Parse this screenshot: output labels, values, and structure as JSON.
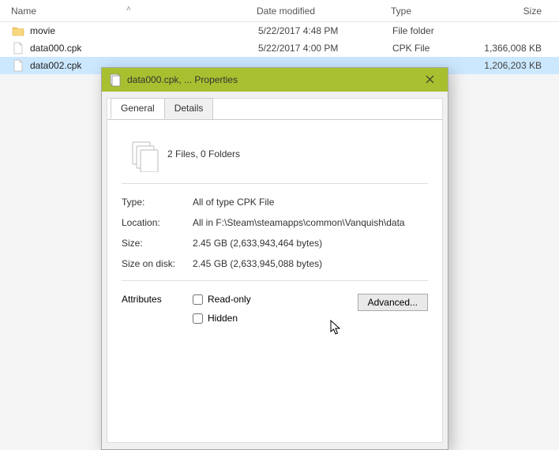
{
  "list": {
    "headers": {
      "name": "Name",
      "date": "Date modified",
      "type": "Type",
      "size": "Size"
    },
    "rows": [
      {
        "icon": "folder",
        "name": "movie",
        "date": "5/22/2017 4:48 PM",
        "type": "File folder",
        "size": ""
      },
      {
        "icon": "file",
        "name": "data000.cpk",
        "date": "5/22/2017 4:00 PM",
        "type": "CPK File",
        "size": "1,366,008 KB"
      },
      {
        "icon": "file",
        "name": "data002.cpk",
        "date": "",
        "type": "",
        "size": "1,206,203 KB"
      }
    ]
  },
  "dialog": {
    "title": "data000.cpk, ... Properties",
    "tabs": {
      "general": "General",
      "details": "Details"
    },
    "summary": "2 Files, 0 Folders",
    "fields": {
      "type_label": "Type:",
      "type_value": "All of type CPK File",
      "location_label": "Location:",
      "location_value": "All in F:\\Steam\\steamapps\\common\\Vanquish\\data",
      "size_label": "Size:",
      "size_value": "2.45 GB (2,633,943,464 bytes)",
      "sizeondisk_label": "Size on disk:",
      "sizeondisk_value": "2.45 GB (2,633,945,088 bytes)"
    },
    "attributes": {
      "label": "Attributes",
      "readonly": "Read-only",
      "hidden": "Hidden",
      "advanced": "Advanced..."
    }
  }
}
